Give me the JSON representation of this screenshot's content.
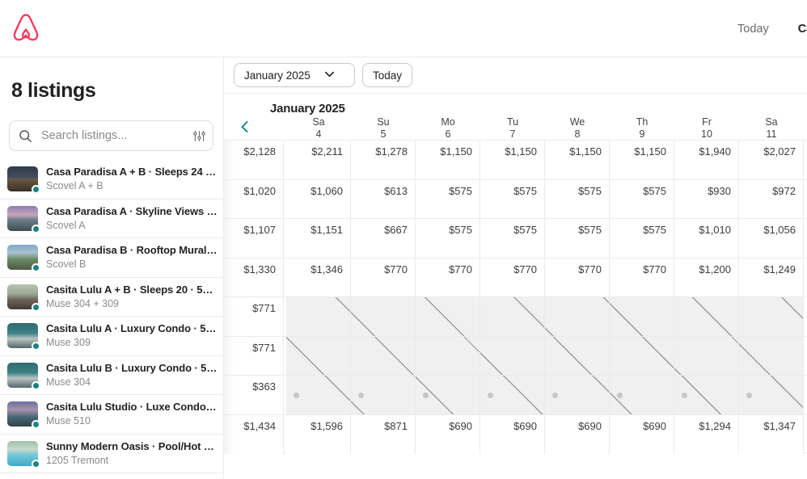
{
  "topbar": {
    "logo_icon": "airbnb-logo-icon",
    "nav": [
      {
        "label": "Today",
        "active": false
      },
      {
        "label": "Ca",
        "active": true
      }
    ]
  },
  "sidebar": {
    "title": "8 listings",
    "search": {
      "placeholder": "Search listings...",
      "value": "",
      "search_icon": "search-icon",
      "filter_icon": "filter-sliders-icon"
    },
    "listings": [
      {
        "name": "Casa Paradisa A + B · Sleeps 24 · 5m...",
        "sub": "Scovel A + B",
        "status_color": "#178287",
        "thumb_kind": "house-night"
      },
      {
        "name": "Casa Paradisa A · Skyline Views · 5...",
        "sub": "Scovel A",
        "status_color": "#178287",
        "thumb_kind": "rooftop-dusk"
      },
      {
        "name": "Casa Paradisa B · Rooftop Mural · 5...",
        "sub": "Scovel B",
        "status_color": "#178287",
        "thumb_kind": "rooftop-day"
      },
      {
        "name": "Casita Lulu A + B · Sleeps 20 · 5min t...",
        "sub": "Muse 304 + 309",
        "status_color": "#178287",
        "thumb_kind": "living-room"
      },
      {
        "name": "Casita Lulu A · Luxury Condo · 5min...",
        "sub": "Muse 309",
        "status_color": "#178287",
        "thumb_kind": "teal-bedroom"
      },
      {
        "name": "Casita Lulu B · Luxury Condo · 5min ...",
        "sub": "Muse 304",
        "status_color": "#178287",
        "thumb_kind": "teal-bedroom"
      },
      {
        "name": "Casita Lulu Studio · Luxe Condo w/ ...",
        "sub": "Muse 510",
        "status_color": "#178287",
        "thumb_kind": "balcony-sunset"
      },
      {
        "name": "Sunny Modern Oasis · Pool/Hot Tub...",
        "sub": "1205 Tremont",
        "status_color": "#178287",
        "thumb_kind": "pool"
      }
    ]
  },
  "calendar": {
    "toolbar": {
      "month_value": "January 2025",
      "month_caret_icon": "chevron-down-icon",
      "today_label": "Today"
    },
    "month_label": "January 2025",
    "prev_icon": "chevron-left-icon",
    "prev_icon_color": "#0e7f87",
    "days": [
      {
        "dow": "",
        "dnum": ""
      },
      {
        "dow": "Sa",
        "dnum": "4"
      },
      {
        "dow": "Su",
        "dnum": "5"
      },
      {
        "dow": "Mo",
        "dnum": "6"
      },
      {
        "dow": "Tu",
        "dnum": "7"
      },
      {
        "dow": "We",
        "dnum": "8"
      },
      {
        "dow": "Th",
        "dnum": "9"
      },
      {
        "dow": "Fr",
        "dnum": "10"
      },
      {
        "dow": "Sa",
        "dnum": "11"
      }
    ],
    "rows": [
      {
        "cells": [
          {
            "price": "$2,128",
            "blocked": false
          },
          {
            "price": "$2,211",
            "blocked": false
          },
          {
            "price": "$1,278",
            "blocked": false
          },
          {
            "price": "$1,150",
            "blocked": false
          },
          {
            "price": "$1,150",
            "blocked": false
          },
          {
            "price": "$1,150",
            "blocked": false
          },
          {
            "price": "$1,150",
            "blocked": false
          },
          {
            "price": "$1,940",
            "blocked": false
          },
          {
            "price": "$2,027",
            "blocked": false
          }
        ]
      },
      {
        "cells": [
          {
            "price": "$1,020",
            "blocked": false
          },
          {
            "price": "$1,060",
            "blocked": false
          },
          {
            "price": "$613",
            "blocked": false
          },
          {
            "price": "$575",
            "blocked": false
          },
          {
            "price": "$575",
            "blocked": false
          },
          {
            "price": "$575",
            "blocked": false
          },
          {
            "price": "$575",
            "blocked": false
          },
          {
            "price": "$930",
            "blocked": false
          },
          {
            "price": "$972",
            "blocked": false
          }
        ]
      },
      {
        "cells": [
          {
            "price": "$1,107",
            "blocked": false
          },
          {
            "price": "$1,151",
            "blocked": false
          },
          {
            "price": "$667",
            "blocked": false
          },
          {
            "price": "$575",
            "blocked": false
          },
          {
            "price": "$575",
            "blocked": false
          },
          {
            "price": "$575",
            "blocked": false
          },
          {
            "price": "$575",
            "blocked": false
          },
          {
            "price": "$1,010",
            "blocked": false
          },
          {
            "price": "$1,056",
            "blocked": false
          }
        ]
      },
      {
        "cells": [
          {
            "price": "$1,330",
            "blocked": false
          },
          {
            "price": "$1,346",
            "blocked": false
          },
          {
            "price": "$770",
            "blocked": false
          },
          {
            "price": "$770",
            "blocked": false
          },
          {
            "price": "$770",
            "blocked": false
          },
          {
            "price": "$770",
            "blocked": false
          },
          {
            "price": "$770",
            "blocked": false
          },
          {
            "price": "$1,200",
            "blocked": false
          },
          {
            "price": "$1,249",
            "blocked": false
          }
        ]
      },
      {
        "cells": [
          {
            "price": "$771",
            "blocked": false
          },
          {
            "price": "",
            "blocked": true
          },
          {
            "price": "",
            "blocked": true
          },
          {
            "price": "",
            "blocked": true
          },
          {
            "price": "",
            "blocked": true
          },
          {
            "price": "",
            "blocked": true
          },
          {
            "price": "",
            "blocked": true
          },
          {
            "price": "",
            "blocked": true
          },
          {
            "price": "",
            "blocked": true
          }
        ]
      },
      {
        "cells": [
          {
            "price": "$771",
            "blocked": false
          },
          {
            "price": "",
            "blocked": true
          },
          {
            "price": "",
            "blocked": true
          },
          {
            "price": "",
            "blocked": true
          },
          {
            "price": "",
            "blocked": true
          },
          {
            "price": "",
            "blocked": true
          },
          {
            "price": "",
            "blocked": true
          },
          {
            "price": "",
            "blocked": true
          },
          {
            "price": "",
            "blocked": true
          }
        ]
      },
      {
        "cells": [
          {
            "price": "$363",
            "blocked": false
          },
          {
            "price": "",
            "blocked": true,
            "dot": true
          },
          {
            "price": "",
            "blocked": true,
            "dot": true
          },
          {
            "price": "",
            "blocked": true,
            "dot": true
          },
          {
            "price": "",
            "blocked": true,
            "dot": true
          },
          {
            "price": "",
            "blocked": true,
            "dot": true
          },
          {
            "price": "",
            "blocked": true,
            "dot": true
          },
          {
            "price": "",
            "blocked": true,
            "dot": true
          },
          {
            "price": "",
            "blocked": true,
            "dot": true
          }
        ]
      },
      {
        "cells": [
          {
            "price": "$1,434",
            "blocked": false
          },
          {
            "price": "$1,596",
            "blocked": false
          },
          {
            "price": "$871",
            "blocked": false
          },
          {
            "price": "$690",
            "blocked": false
          },
          {
            "price": "$690",
            "blocked": false
          },
          {
            "price": "$690",
            "blocked": false
          },
          {
            "price": "$690",
            "blocked": false
          },
          {
            "price": "$1,294",
            "blocked": false
          },
          {
            "price": "$1,347",
            "blocked": false
          }
        ]
      }
    ]
  }
}
